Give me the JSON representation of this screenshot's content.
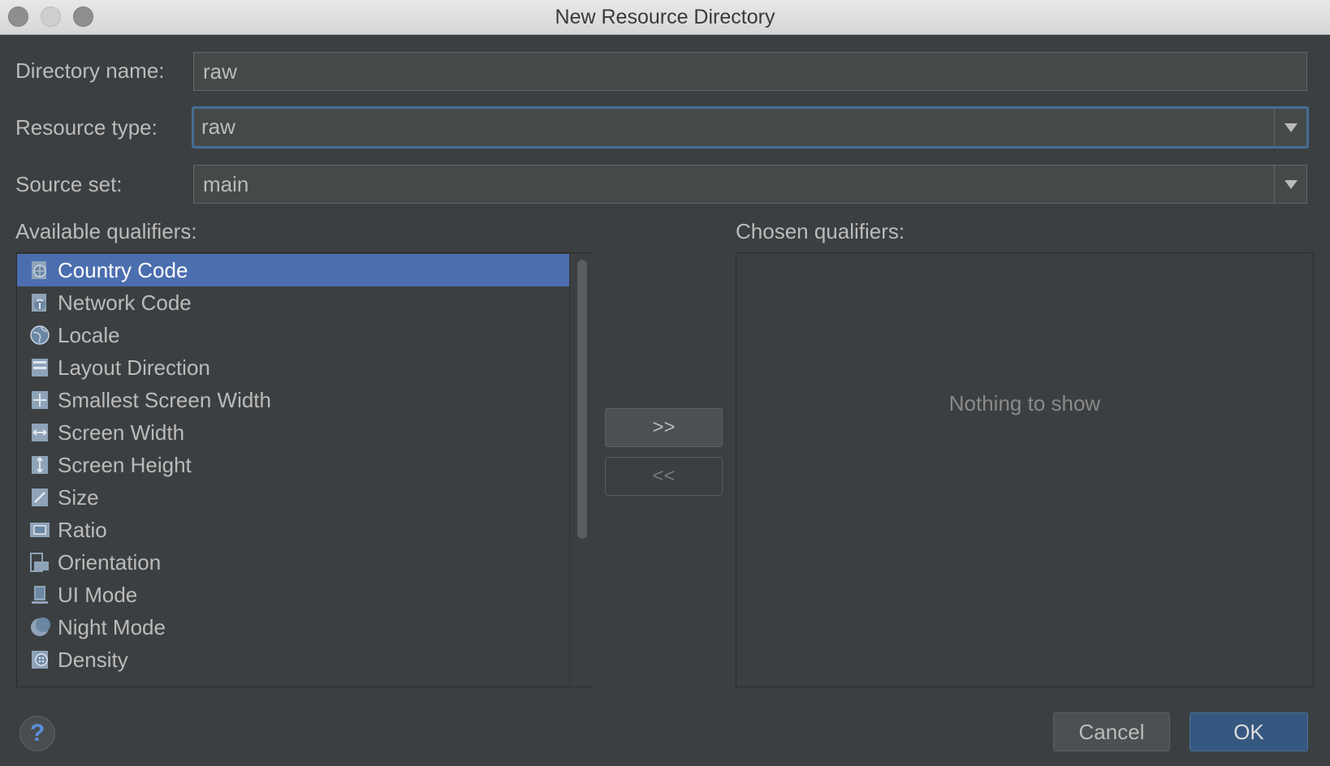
{
  "window": {
    "title": "New Resource Directory"
  },
  "form": {
    "directory_name_label": "Directory name:",
    "directory_name_value": "raw",
    "resource_type_label": "Resource type:",
    "resource_type_value": "raw",
    "source_set_label": "Source set:",
    "source_set_value": "main"
  },
  "available": {
    "label": "Available qualifiers:",
    "items": [
      {
        "label": "Country Code",
        "icon": "country-code-icon",
        "selected": true
      },
      {
        "label": "Network Code",
        "icon": "network-code-icon"
      },
      {
        "label": "Locale",
        "icon": "globe-icon"
      },
      {
        "label": "Layout Direction",
        "icon": "layout-direction-icon"
      },
      {
        "label": "Smallest Screen Width",
        "icon": "smallest-width-icon"
      },
      {
        "label": "Screen Width",
        "icon": "screen-width-icon"
      },
      {
        "label": "Screen Height",
        "icon": "screen-height-icon"
      },
      {
        "label": "Size",
        "icon": "size-icon"
      },
      {
        "label": "Ratio",
        "icon": "ratio-icon"
      },
      {
        "label": "Orientation",
        "icon": "orientation-icon"
      },
      {
        "label": "UI Mode",
        "icon": "ui-mode-icon"
      },
      {
        "label": "Night Mode",
        "icon": "night-mode-icon"
      },
      {
        "label": "Density",
        "icon": "density-icon"
      }
    ]
  },
  "transfer": {
    "add_label": ">>",
    "remove_label": "<<"
  },
  "chosen": {
    "label": "Chosen qualifiers:",
    "empty_text": "Nothing to show"
  },
  "footer": {
    "help_label": "?",
    "cancel_label": "Cancel",
    "ok_label": "OK"
  },
  "colors": {
    "background": "#3c3f41",
    "selection": "#4b6eaf",
    "focus_border": "#466d94",
    "ok_button": "#365880"
  }
}
